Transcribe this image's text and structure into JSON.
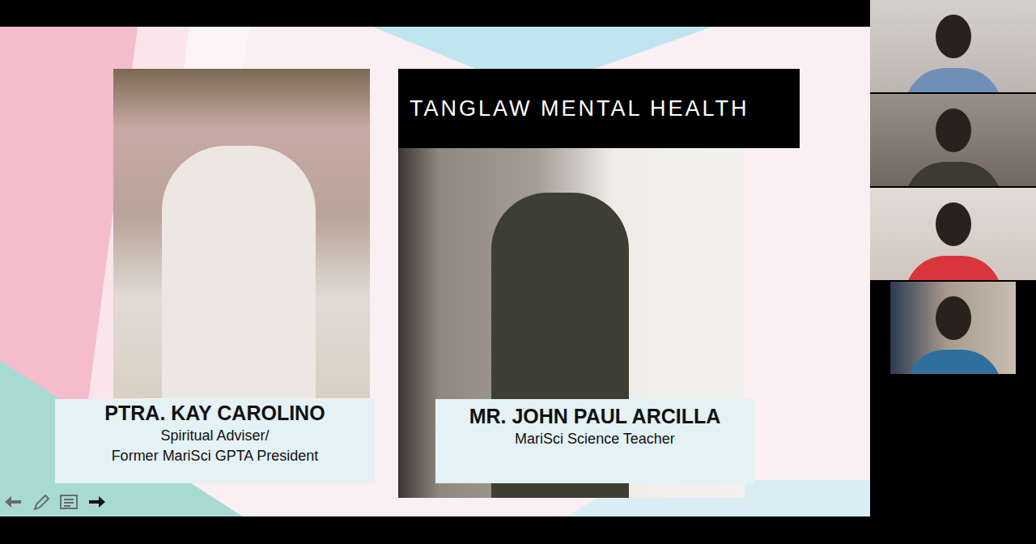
{
  "slide": {
    "header": "TANGLAW MENTAL HEALTH",
    "speakers": [
      {
        "name": "PTRA. KAY CAROLINO",
        "roles": [
          "Spiritual Adviser/",
          "Former MariSci GPTA President"
        ]
      },
      {
        "name": "MR. JOHN PAUL ARCILLA",
        "roles": [
          "MariSci Science Teacher"
        ]
      }
    ]
  }
}
